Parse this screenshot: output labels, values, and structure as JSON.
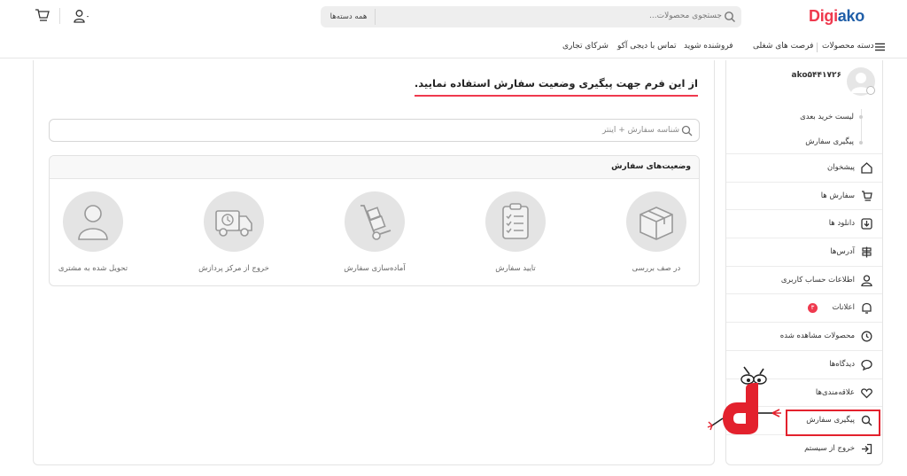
{
  "header": {
    "logo_part1": "Digi",
    "logo_part2": "ako",
    "search_placeholder": "جستجوی محصولات...",
    "category_button": "همه دسته‌ها"
  },
  "nav": {
    "items": [
      {
        "label": "دسته محصولات"
      },
      {
        "label": "فرصت های شغلی"
      },
      {
        "label": "فروشنده شوید"
      },
      {
        "label": "تماس با دیجی آکو"
      },
      {
        "label": "شرکای تجاری"
      }
    ]
  },
  "main": {
    "form_title": "از این فرم جهت پیگیری وضعیت سفارش استفاده نمایید.",
    "tracking_placeholder": "شناسه سفارش + اینتر",
    "status_title": "وضعیت‌های سفارش",
    "steps": [
      {
        "label": "در صف بررسی",
        "icon": "box-icon"
      },
      {
        "label": "تایید سفارش",
        "icon": "clipboard-icon"
      },
      {
        "label": "آماده‌سازی سفارش",
        "icon": "hand-truck-icon"
      },
      {
        "label": "خروج از مرکز پردازش",
        "icon": "delivery-truck-icon"
      },
      {
        "label": "تحویل شده به مشتری",
        "icon": "user-icon"
      }
    ]
  },
  "sidebar": {
    "username": "ako۵۴۴۱۷۲۶",
    "sub_items": [
      {
        "label": "لیست خرید بعدی"
      },
      {
        "label": "پیگیری سفارش"
      }
    ],
    "menu": [
      {
        "label": "پیشخوان",
        "icon": "home-icon"
      },
      {
        "label": "سفارش ها",
        "icon": "cart-icon"
      },
      {
        "label": "دانلود ها",
        "icon": "download-icon"
      },
      {
        "label": "آدرس‌ها",
        "icon": "signpost-icon"
      },
      {
        "label": "اطلاعات حساب کاربری",
        "icon": "user-icon"
      },
      {
        "label": "اعلانات",
        "icon": "bell-icon",
        "badge": "۳"
      },
      {
        "label": "محصولات مشاهده شده",
        "icon": "history-icon"
      },
      {
        "label": "دیدگاه‌ها",
        "icon": "comment-icon"
      },
      {
        "label": "علاقه‌مندی‌ها",
        "icon": "heart-icon"
      },
      {
        "label": "پیگیری سفارش",
        "icon": "search-icon"
      },
      {
        "label": "خروج از سیستم",
        "icon": "logout-icon"
      }
    ]
  },
  "colors": {
    "brand_red": "#ef394e",
    "brand_blue": "#1f5ea8",
    "highlight_red": "#e3212d"
  }
}
